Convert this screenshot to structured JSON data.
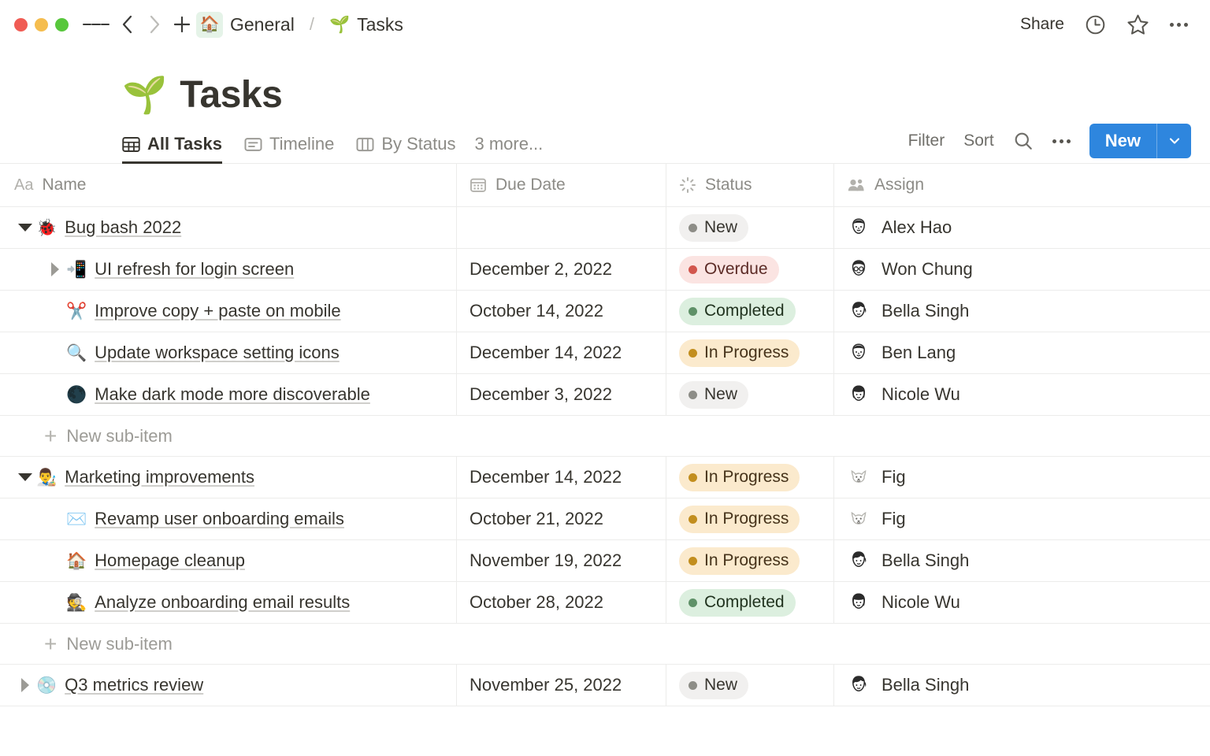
{
  "titlebar": {
    "breadcrumb": {
      "home_emoji": "🏠",
      "parent": "General",
      "separator": "/",
      "child_emoji": "🌱",
      "child": "Tasks"
    },
    "share_label": "Share",
    "icons": [
      "hamburger-icon",
      "back-chevron-icon",
      "forward-chevron-icon",
      "plus-icon",
      "history-clock-icon",
      "star-icon",
      "more-options-icon"
    ]
  },
  "page": {
    "emoji": "🌱",
    "title": "Tasks"
  },
  "views": {
    "tabs": [
      {
        "label": "All Tasks",
        "icon": "table-grid-icon",
        "active": true
      },
      {
        "label": "Timeline",
        "icon": "timeline-icon",
        "active": false
      },
      {
        "label": "By Status",
        "icon": "board-columns-icon",
        "active": false
      }
    ],
    "more_label": "3 more...",
    "filter_label": "Filter",
    "sort_label": "Sort",
    "search_icon": "search-icon",
    "more_icon": "more-options-icon",
    "new_label": "New",
    "new_caret_icon": "chevron-down-icon",
    "accent_color": "#2e86de"
  },
  "table": {
    "columns": [
      {
        "label": "Name",
        "icon": "text-aa-icon"
      },
      {
        "label": "Due Date",
        "icon": "calendar-icon"
      },
      {
        "label": "Status",
        "icon": "status-spinner-icon"
      },
      {
        "label": "Assign",
        "icon": "people-icon"
      }
    ],
    "new_subitem_label": "New sub-item",
    "rows": [
      {
        "type": "parent",
        "toggle": "open",
        "indent": 0,
        "emoji": "🐞",
        "name": "Bug bash 2022",
        "due": "",
        "status": "New",
        "status_key": "s-new",
        "assignee": "Alex Hao",
        "avatar": "face-short-hair"
      },
      {
        "type": "child",
        "toggle": "closed",
        "indent": 1,
        "emoji": "📲",
        "name": "UI refresh for login screen",
        "due": "December 2, 2022",
        "status": "Overdue",
        "status_key": "s-overdue",
        "assignee": "Won Chung",
        "avatar": "face-glasses"
      },
      {
        "type": "child",
        "toggle": "none",
        "indent": 1,
        "emoji": "✂️",
        "name": "Improve copy + paste on mobile",
        "due": "October 14, 2022",
        "status": "Completed",
        "status_key": "s-completed",
        "assignee": "Bella Singh",
        "avatar": "face-ponytail"
      },
      {
        "type": "child",
        "toggle": "none",
        "indent": 1,
        "emoji": "🔍",
        "name": "Update workspace setting icons",
        "due": "December 14, 2022",
        "status": "In Progress",
        "status_key": "s-progress",
        "assignee": "Ben Lang",
        "avatar": "face-short-hair"
      },
      {
        "type": "child",
        "toggle": "none",
        "indent": 1,
        "emoji": "🌑",
        "name": "Make dark mode more discoverable",
        "due": "December 3, 2022",
        "status": "New",
        "status_key": "s-new",
        "assignee": "Nicole Wu",
        "avatar": "face-bob"
      },
      {
        "type": "new-subitem"
      },
      {
        "type": "parent",
        "toggle": "open",
        "indent": 0,
        "emoji": "👨‍🎨",
        "name": "Marketing improvements",
        "due": "December 14, 2022",
        "status": "In Progress",
        "status_key": "s-progress",
        "assignee": "Fig",
        "avatar": "dog"
      },
      {
        "type": "child",
        "toggle": "none",
        "indent": 1,
        "emoji": "✉️",
        "name": "Revamp user onboarding emails",
        "due": "October 21, 2022",
        "status": "In Progress",
        "status_key": "s-progress",
        "assignee": "Fig",
        "avatar": "dog"
      },
      {
        "type": "child",
        "toggle": "none",
        "indent": 1,
        "emoji": "🏠",
        "name": "Homepage cleanup",
        "due": "November 19, 2022",
        "status": "In Progress",
        "status_key": "s-progress",
        "assignee": "Bella Singh",
        "avatar": "face-ponytail"
      },
      {
        "type": "child",
        "toggle": "none",
        "indent": 1,
        "emoji": "🕵️",
        "name": "Analyze onboarding email results",
        "due": "October 28, 2022",
        "status": "Completed",
        "status_key": "s-completed",
        "assignee": "Nicole Wu",
        "avatar": "face-bob"
      },
      {
        "type": "new-subitem"
      },
      {
        "type": "parent",
        "toggle": "closed",
        "indent": 0,
        "emoji": "💿",
        "name": "Q3 metrics review",
        "due": "November 25, 2022",
        "status": "New",
        "status_key": "s-new",
        "assignee": "Bella Singh",
        "avatar": "face-ponytail"
      }
    ]
  }
}
